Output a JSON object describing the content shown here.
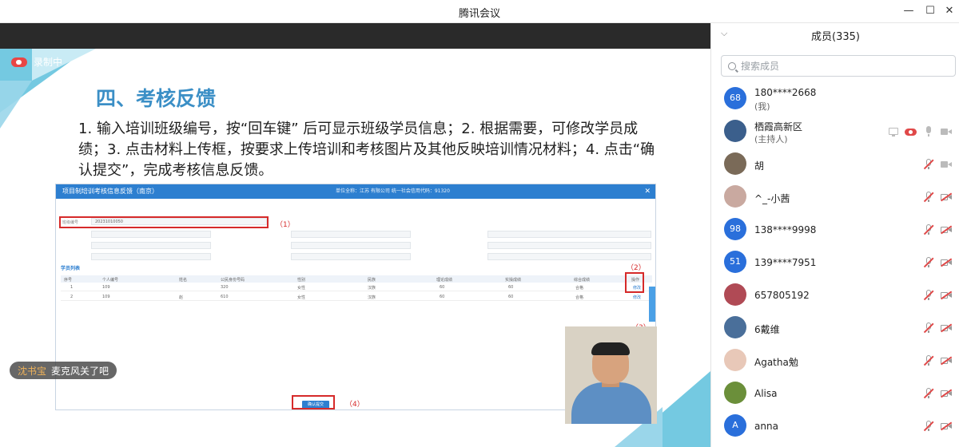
{
  "window": {
    "title": "腾讯会议"
  },
  "recording": {
    "label": "录制中"
  },
  "slide": {
    "heading": "四、考核反馈",
    "body": "1. 输入培训班级编号，按“回车键” 后可显示班级学员信息；2. 根据需要，可修改学员成绩；3. 点击材料上传框，按要求上传培训和考核图片及其他反映培训情况材料；4. 点击“确认提交”，完成考核信息反馈。"
  },
  "embedded_screenshot": {
    "header_title": "项目制培训考核信息反馈（南京）",
    "header_meta": "单位全称：江苏              有限公司     统一社会信用代码：91320",
    "class_no_label": "班级编号",
    "class_no_value": "20231010050",
    "section_label": "学员列表",
    "columns": [
      "序号",
      "个人编号",
      "姓名",
      "公民身份号码",
      "性别",
      "民族",
      "理论成绩",
      "实操成绩",
      "综合成绩",
      "操作"
    ],
    "rows": [
      [
        "1",
        "109",
        "",
        "320",
        "女性",
        "汉族",
        "60",
        "60",
        "合格",
        "修改"
      ],
      [
        "2",
        "109",
        "赵",
        "610",
        "女性",
        "汉族",
        "60",
        "60",
        "合格",
        "修改"
      ]
    ],
    "submit_label": "确认提交",
    "annotations": [
      "（1）",
      "（2）",
      "（3）",
      "（4）"
    ]
  },
  "danmu": {
    "sender": "沈书宝",
    "message": "麦克风关了吧"
  },
  "members": {
    "title": "成员(335)",
    "search_placeholder": "搜索成员",
    "list": [
      {
        "name": "180****2668",
        "sub": "(我)",
        "avatar_text": "68",
        "avatar_color": "#2a6fdb"
      },
      {
        "name": "栖霞高新区",
        "sub": "(主持人)",
        "avatar_text": "",
        "avatar_color": "#3b5f8c"
      },
      {
        "name": "胡",
        "sub": "",
        "avatar_text": "",
        "avatar_color": "#7a6a58"
      },
      {
        "name": "^_-小茜",
        "sub": "",
        "avatar_text": "",
        "avatar_color": "#c9a9a0"
      },
      {
        "name": "138****9998",
        "sub": "",
        "avatar_text": "98",
        "avatar_color": "#2a6fdb"
      },
      {
        "name": "139****7951",
        "sub": "",
        "avatar_text": "51",
        "avatar_color": "#2a6fdb"
      },
      {
        "name": "657805192",
        "sub": "",
        "avatar_text": "",
        "avatar_color": "#b04a55"
      },
      {
        "name": "6戴维",
        "sub": "",
        "avatar_text": "",
        "avatar_color": "#4a6f9a"
      },
      {
        "name": "Agatha勉",
        "sub": "",
        "avatar_text": "",
        "avatar_color": "#e8c8b8"
      },
      {
        "name": "Alisa",
        "sub": "",
        "avatar_text": "",
        "avatar_color": "#6b8f3a"
      },
      {
        "name": "anna",
        "sub": "",
        "avatar_text": "A",
        "avatar_color": "#2a6fdb"
      }
    ]
  }
}
